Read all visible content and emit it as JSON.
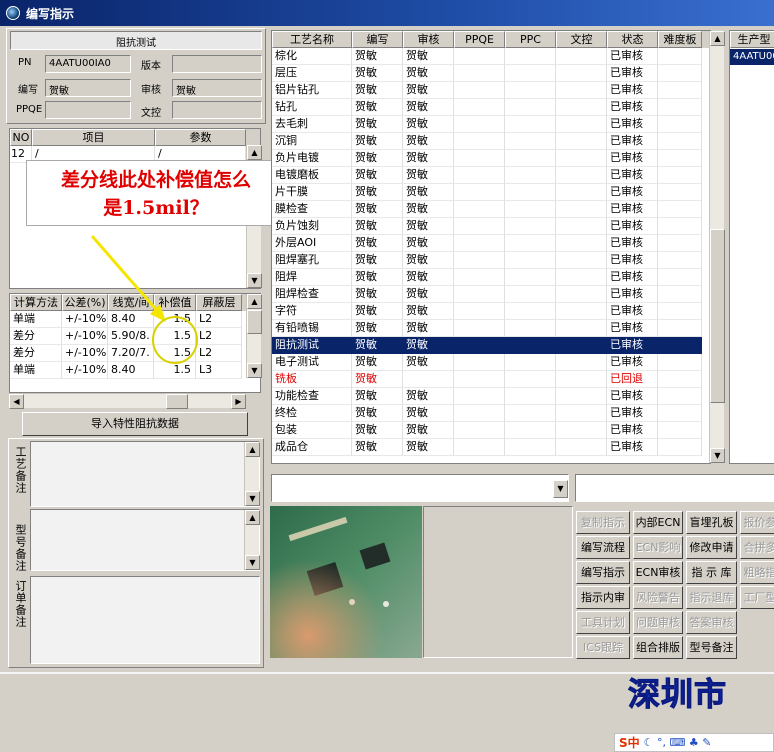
{
  "window": {
    "title": "编写指示"
  },
  "left": {
    "section_title": "阻抗测试",
    "pn_label": "PN",
    "pn_value": "4AATU00IA0",
    "version_label": "版本",
    "version_value": "",
    "writer_label": "编写",
    "writer_value": "贺敏",
    "reviewer_label": "审核",
    "reviewer_value": "贺敏",
    "ppqe_label": "PPQE",
    "ppqe_value": "",
    "wenkong_label": "文控",
    "wenkong_value": "",
    "items_grid": {
      "headers": [
        "NO",
        "项目",
        "参数"
      ],
      "rows": [
        [
          "12",
          "/",
          "/"
        ]
      ]
    },
    "callout": {
      "line1": "差分线此处补偿值怎么",
      "line2": "是1.5mil？"
    },
    "imp_grid": {
      "headers": [
        "计算方法",
        "公差(%)",
        "线宽/间",
        "补偿值",
        "屏蔽层"
      ],
      "rows": [
        [
          "单端",
          "+/-10%",
          "8.40",
          "1.5",
          "L2"
        ],
        [
          "差分",
          "+/-10%",
          "5.90/8.",
          "1.5",
          "L2"
        ],
        [
          "差分",
          "+/-10%",
          "7.20/7.",
          "1.5",
          "L2"
        ],
        [
          "单端",
          "+/-10%",
          "8.40",
          "1.5",
          "L3"
        ]
      ]
    },
    "import_button": "导入特性阻抗数据",
    "remark1_label": "工艺备注",
    "remark2_label": "型号备注",
    "remark3_label": "订单备注"
  },
  "process_grid": {
    "headers": [
      "工艺名称",
      "编写",
      "审核",
      "PPQE",
      "PPC",
      "文控",
      "状态",
      "难度板"
    ],
    "rows": [
      [
        "棕化",
        "贺敏",
        "贺敏",
        "",
        "",
        "",
        "已审核",
        ""
      ],
      [
        "层压",
        "贺敏",
        "贺敏",
        "",
        "",
        "",
        "已审核",
        ""
      ],
      [
        "铝片钻孔",
        "贺敏",
        "贺敏",
        "",
        "",
        "",
        "已审核",
        ""
      ],
      [
        "钻孔",
        "贺敏",
        "贺敏",
        "",
        "",
        "",
        "已审核",
        ""
      ],
      [
        "去毛刺",
        "贺敏",
        "贺敏",
        "",
        "",
        "",
        "已审核",
        ""
      ],
      [
        "沉铜",
        "贺敏",
        "贺敏",
        "",
        "",
        "",
        "已审核",
        ""
      ],
      [
        "负片电镀",
        "贺敏",
        "贺敏",
        "",
        "",
        "",
        "已审核",
        ""
      ],
      [
        "电镀磨板",
        "贺敏",
        "贺敏",
        "",
        "",
        "",
        "已审核",
        ""
      ],
      [
        "片干膜",
        "贺敏",
        "贺敏",
        "",
        "",
        "",
        "已审核",
        ""
      ],
      [
        "膜检查",
        "贺敏",
        "贺敏",
        "",
        "",
        "",
        "已审核",
        ""
      ],
      [
        "负片蚀刻",
        "贺敏",
        "贺敏",
        "",
        "",
        "",
        "已审核",
        ""
      ],
      [
        "外层AOI",
        "贺敏",
        "贺敏",
        "",
        "",
        "",
        "已审核",
        ""
      ],
      [
        "阻焊塞孔",
        "贺敏",
        "贺敏",
        "",
        "",
        "",
        "已审核",
        ""
      ],
      [
        "阻焊",
        "贺敏",
        "贺敏",
        "",
        "",
        "",
        "已审核",
        ""
      ],
      [
        "阻焊检查",
        "贺敏",
        "贺敏",
        "",
        "",
        "",
        "已审核",
        ""
      ],
      [
        "字符",
        "贺敏",
        "贺敏",
        "",
        "",
        "",
        "已审核",
        ""
      ],
      [
        "有铅喷锡",
        "贺敏",
        "贺敏",
        "",
        "",
        "",
        "已审核",
        ""
      ],
      [
        "阻抗测试",
        "贺敏",
        "贺敏",
        "",
        "",
        "",
        "已审核",
        ""
      ],
      [
        "电子测试",
        "贺敏",
        "贺敏",
        "",
        "",
        "",
        "已审核",
        ""
      ],
      [
        "铣板",
        "贺敏",
        "",
        "",
        "",
        "",
        "已回退",
        ""
      ],
      [
        "功能检查",
        "贺敏",
        "贺敏",
        "",
        "",
        "",
        "已审核",
        ""
      ],
      [
        "终检",
        "贺敏",
        "贺敏",
        "",
        "",
        "",
        "已审核",
        ""
      ],
      [
        "包装",
        "贺敏",
        "贺敏",
        "",
        "",
        "",
        "已审核",
        ""
      ],
      [
        "成品仓",
        "贺敏",
        "贺敏",
        "",
        "",
        "",
        "已审核",
        ""
      ]
    ]
  },
  "right_panel": {
    "header": "生产型",
    "value": "4AATU00"
  },
  "buttons": [
    [
      "复制指示",
      "内部ECN",
      "盲埋孔板",
      "报价参"
    ],
    [
      "编写流程",
      "ECN影响",
      "修改申请",
      "合拼多"
    ],
    [
      "编写指示",
      "ECN审核",
      "指 示 库",
      "粗略指"
    ],
    [
      "指示内审",
      "风险警告",
      "指示退库",
      "工厂型"
    ],
    [
      "工具计划",
      "问题审核",
      "答案审核",
      ""
    ],
    [
      "ICS跟踪",
      "组合排版",
      "型号备注",
      ""
    ]
  ],
  "taskbar": {
    "brand": "深圳市",
    "ime": "S中",
    "ime_icons": "☾ °, ⌨ ♣ ✎"
  }
}
